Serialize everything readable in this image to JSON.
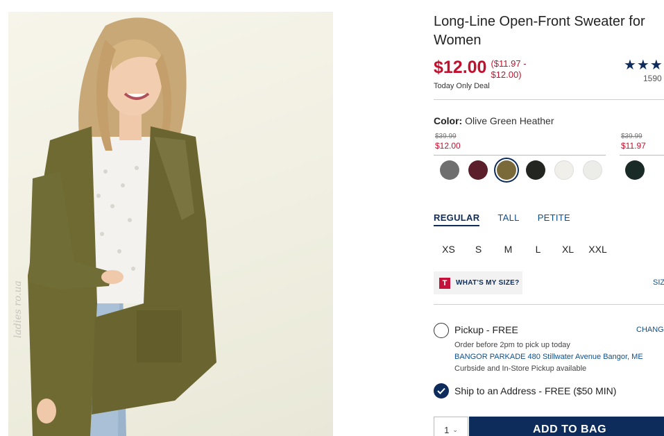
{
  "product": {
    "title": "Long-Line Open-Front Sweater for Women",
    "price": "$12.00",
    "price_range": "($11.97 - $12.00)",
    "deal_label": "Today Only Deal",
    "rating_stars": "★★★",
    "review_count": "1590"
  },
  "color": {
    "label": "Color:",
    "selected_name": "Olive Green Heather",
    "groups": [
      {
        "original": "$39.99",
        "sale": "$12.00"
      },
      {
        "original": "$39.99",
        "sale": "$11.97"
      }
    ],
    "swatches": [
      {
        "color": "#6f6f6f"
      },
      {
        "color": "#5a1f2b"
      },
      {
        "color": "#7a6a3a"
      },
      {
        "color": "#232521"
      },
      {
        "color": "#f1efe9"
      },
      {
        "color": "#ecece8"
      },
      {
        "color": "#1a2b27"
      }
    ]
  },
  "fit": {
    "tabs": [
      "REGULAR",
      "TALL",
      "PETITE"
    ],
    "active": "REGULAR"
  },
  "sizes": [
    "XS",
    "S",
    "M",
    "L",
    "XL",
    "XXL"
  ],
  "size_help": {
    "logo": "T",
    "label": "WHAT'S MY SIZE?",
    "chart_link": "SIZ"
  },
  "pickup": {
    "label": "Pickup - FREE",
    "change": "CHANG",
    "order_before": "Order before 2pm to pick up today",
    "store": "BANGOR PARKADE 480 Stillwater Avenue  Bangor, ME",
    "availability": "Curbside and In-Store Pickup available"
  },
  "ship": {
    "label": "Ship to an Address - FREE ($50 MIN)"
  },
  "cart": {
    "quantity": "1",
    "add_button": "ADD TO BAG"
  },
  "image": {
    "watermark": "ladies ro.ua"
  }
}
